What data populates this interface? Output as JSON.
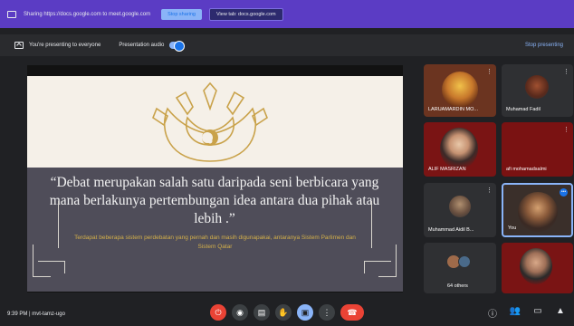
{
  "share_bar": {
    "text": "Sharing https://docs.google.com to meet.google.com",
    "stop_label": "Stop sharing",
    "view_tab_label": "View tab: docs.google.com"
  },
  "present_bar": {
    "text": "You're presenting to everyone",
    "audio_label": "Presentation audio",
    "audio_on": true,
    "stop_label": "Stop presenting"
  },
  "slide": {
    "quote": "“Debat merupakan salah satu daripada seni berbicara yang mana berlakunya pertembungan idea antara dua pihak atau lebih .”",
    "subquote": "Terdapat beberapa sistem perdebatan yang pernah dan masih digunapakai, antaranya Sistem Parlimen dan Sistem Qatar",
    "accent_color": "#c9a24a"
  },
  "participants": [
    {
      "name": "LARUAMARDIN MO..."
    },
    {
      "name": "Muhamad Fadil"
    },
    {
      "name": "ALIF MASRIZAN"
    },
    {
      "name": "afi mohamadsalmi"
    },
    {
      "name": "Muhammad Aidil B..."
    },
    {
      "name": "You"
    },
    {
      "name": "64 others"
    },
    {
      "name": ""
    }
  ],
  "bottom": {
    "meeting_info": "9:39 PM | mvt-tamz-ugo"
  }
}
